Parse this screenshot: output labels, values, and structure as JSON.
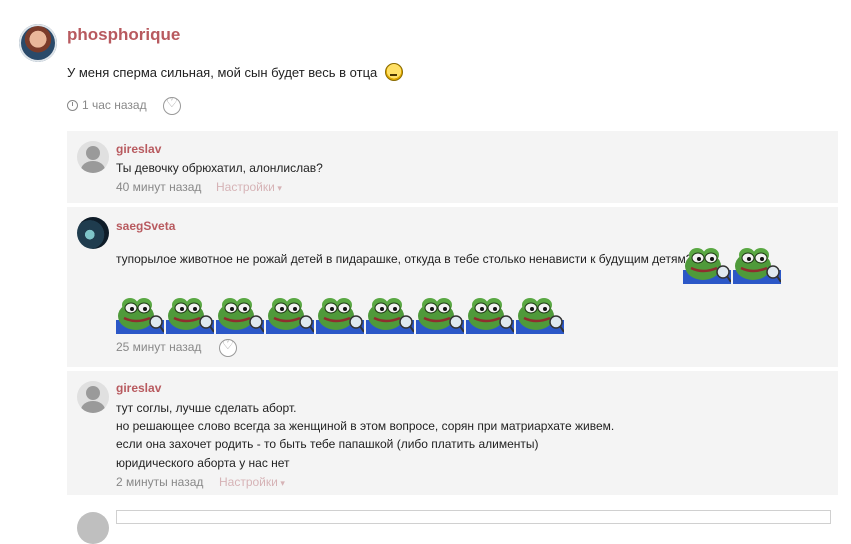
{
  "post": {
    "author": "phosphorique",
    "text": "У меня сперма сильная, мой сын будет весь в отца",
    "time": "1 час назад"
  },
  "comments": [
    {
      "author": "gireslav",
      "lines": [
        "Ты девочку обрюхатил, алонлислав?"
      ],
      "time": "40 минут назад",
      "settings": "Настройки"
    },
    {
      "author": "saegSveta",
      "lines": [
        "тупорылое животное не рожай детей в пидарашке, откуда в тебе столько ненависти к будущим детям?"
      ],
      "time": "25 минут назад",
      "emoji_count": 11
    },
    {
      "author": "gireslav",
      "lines": [
        "тут соглы, лучше сделать аборт.",
        "но решающее слово всегда за женщиной в этом вопросе, сорян при матриархате живем.",
        "если она захочет родить - то быть тебе папашкой (либо платить алименты)",
        "юридического аборта у нас нет"
      ],
      "time": "2 минуты назад",
      "settings": "Настройки"
    }
  ],
  "colors": {
    "author": "#b85a5f",
    "panel": "#f4f4f4",
    "meta": "#888888"
  },
  "icons": {
    "clock": "clock-icon",
    "like": "heart-icon",
    "emoji": "pepe-sticker-icon"
  }
}
